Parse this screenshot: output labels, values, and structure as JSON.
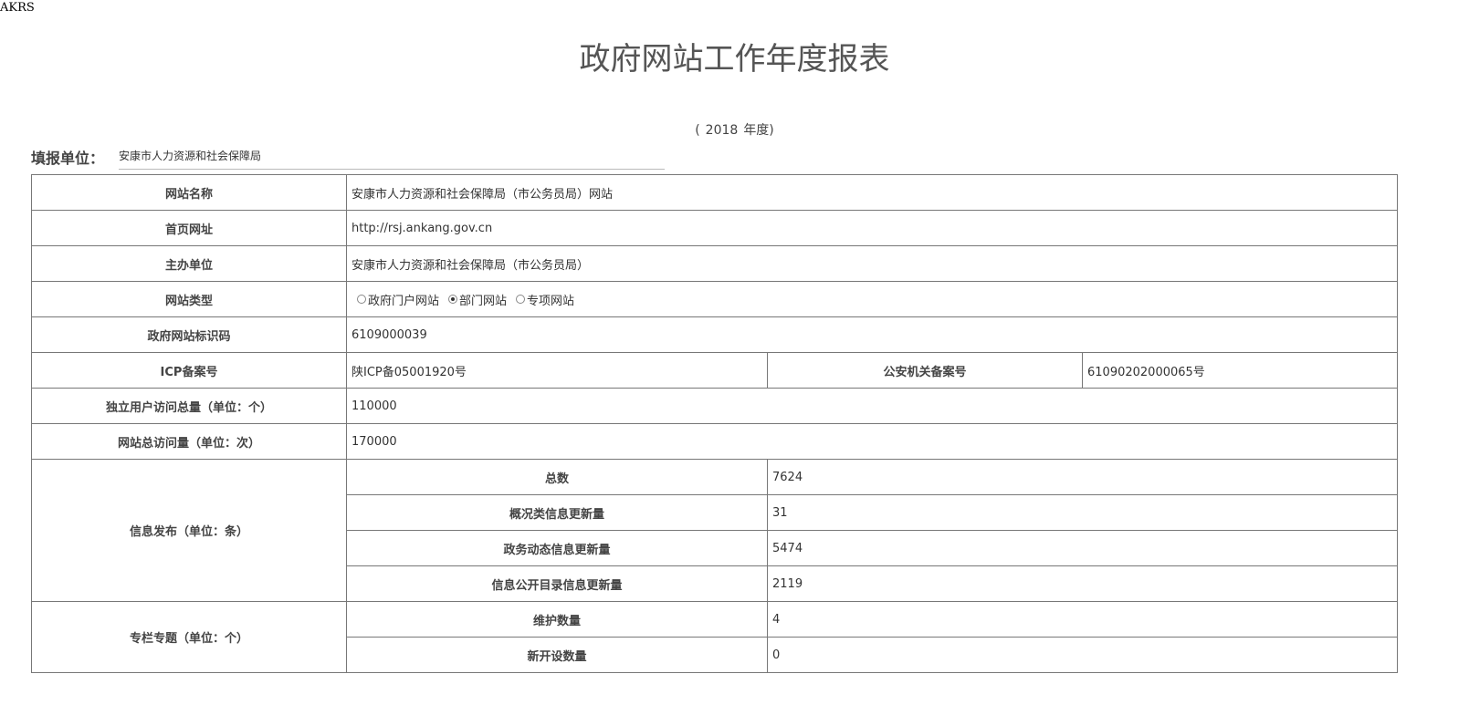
{
  "corner_tag": "AKRS",
  "title": "政府网站工作年度报表",
  "year": {
    "open": "(",
    "year": "2018",
    "suffix": "年度)"
  },
  "filing_unit": {
    "label": "填报单位：",
    "value": "安康市人力资源和社会保障局"
  },
  "rows": {
    "site_name": {
      "label": "网站名称",
      "value": "安康市人力资源和社会保障局（市公务员局）网站"
    },
    "homepage_url": {
      "label": "首页网址",
      "value": "http://rsj.ankang.gov.cn"
    },
    "sponsor": {
      "label": "主办单位",
      "value": "安康市人力资源和社会保障局（市公务员局）"
    },
    "site_type": {
      "label": "网站类型",
      "options": [
        {
          "label": "政府门户网站",
          "checked": false
        },
        {
          "label": "部门网站",
          "checked": true
        },
        {
          "label": "专项网站",
          "checked": false
        }
      ]
    },
    "site_id_code": {
      "label": "政府网站标识码",
      "value": "6109000039"
    },
    "icp": {
      "label": "ICP备案号",
      "value": "陕ICP备05001920号"
    },
    "police_record": {
      "label": "公安机关备案号",
      "value": "61090202000065号"
    },
    "unique_visitors": {
      "label": "独立用户访问总量（单位：个）",
      "value": "110000"
    },
    "total_visits": {
      "label": "网站总访问量（单位：次）",
      "value": "170000"
    },
    "info_publish": {
      "label": "信息发布（单位：条）",
      "items": [
        {
          "label": "总数",
          "value": "7624"
        },
        {
          "label": "概况类信息更新量",
          "value": "31"
        },
        {
          "label": "政务动态信息更新量",
          "value": "5474"
        },
        {
          "label": "信息公开目录信息更新量",
          "value": "2119"
        }
      ]
    },
    "columns": {
      "label": "专栏专题（单位：个）",
      "items": [
        {
          "label": "维护数量",
          "value": "4"
        },
        {
          "label": "新开设数量",
          "value": "0"
        }
      ]
    }
  }
}
